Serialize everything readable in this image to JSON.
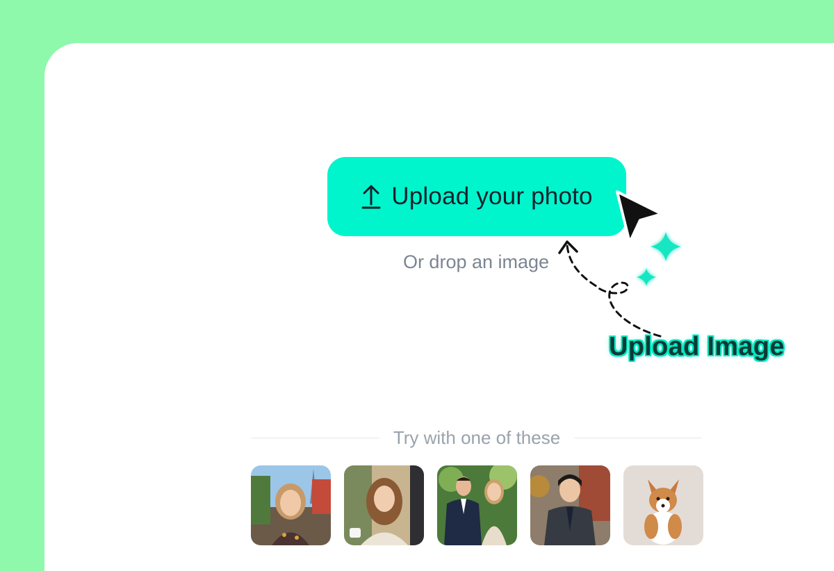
{
  "upload": {
    "button_label": "Upload your photo",
    "drop_text": "Or drop an image"
  },
  "annotation": {
    "label": "Upload Image"
  },
  "samples": {
    "heading": "Try with one of these",
    "items": [
      {
        "subject": "woman in front of Eiffel Tower"
      },
      {
        "subject": "smiling woman at cafe"
      },
      {
        "subject": "couple in formal wear"
      },
      {
        "subject": "young man in suit"
      },
      {
        "subject": "corgi puppy"
      }
    ]
  },
  "colors": {
    "background": "#8ef8ab",
    "panel": "#ffffff",
    "accent": "#00f5cc",
    "text_dark": "#14212b",
    "text_muted": "#7b8592"
  },
  "icons": [
    "upload-arrow-icon",
    "cursor-pointer-icon",
    "sparkle-icon"
  ]
}
